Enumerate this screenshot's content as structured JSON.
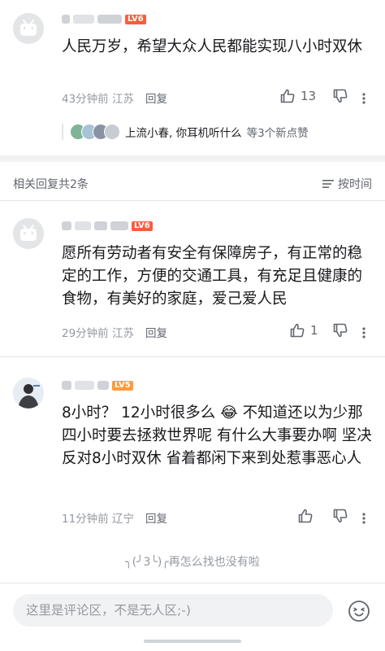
{
  "comments": [
    {
      "level": "LV6",
      "text": "人民万岁，希望大众人民都能实现八小时双休",
      "time": "43分钟前",
      "location": "江苏",
      "reply_label": "回复",
      "likes": "13"
    },
    {
      "level": "LV6",
      "text": "愿所有劳动者有安全有保障房子，有正常的稳定的工作，方便的交通工具，有充足且健康的食物，有美好的家庭，爱己爱人民",
      "time": "29分钟前",
      "location": "江苏",
      "reply_label": "回复",
      "likes": "1"
    },
    {
      "level": "LV5",
      "text_before": "8小时？ 12小时很多么",
      "emoji": "😂",
      "text_after": "不知道还以为少那四小时要去拯救世界呢 有什么大事要办啊 坚决反对8小时双休 省着都闲下来到处惹事恶心人",
      "time": "11分钟前",
      "location": "辽宁",
      "reply_label": "回复",
      "likes": ""
    }
  ],
  "liked_by": {
    "names": "上流小春, 你耳机听什么",
    "suffix": "等3个新点赞"
  },
  "related": {
    "count_label": "相关回复共2条",
    "sort_label": "按时间"
  },
  "end_message": "╮(╯3╰)╭再怎么找也没有啦",
  "input": {
    "placeholder": "这里是评论区，不是无人区;-)"
  },
  "colors": {
    "lv6": "#ff5b3d",
    "lv5": "#ff9a3c",
    "link": "#18191c",
    "meta": "#9499a0"
  }
}
